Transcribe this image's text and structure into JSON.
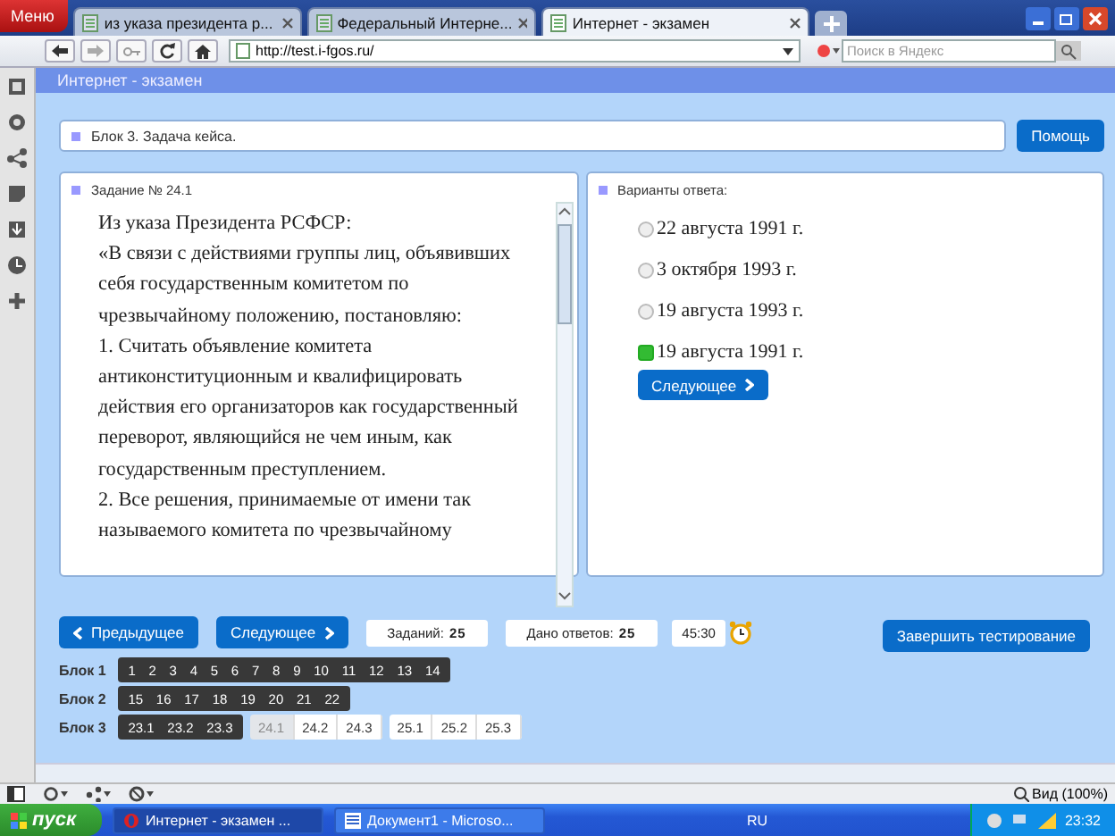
{
  "browser": {
    "menu": "Меню",
    "tabs": [
      {
        "label": "из указа президента р...",
        "selected": false
      },
      {
        "label": "Федеральный Интерне...",
        "selected": false
      },
      {
        "label": "Интернет - экзамен",
        "selected": true
      }
    ],
    "url": "http://test.i-fgos.ru/",
    "search": {
      "placeholder": "Поиск в Яндекс"
    }
  },
  "page_title": "Интернет - экзамен",
  "block_label": "Блок 3. Задача кейса.",
  "help_button": "Помощь",
  "task": {
    "title": "Задание № 24.1",
    "paragraphs": [
      "Из указа Президента РСФСР:",
      "«В связи с действиями группы лиц, объявивших себя государственным комитетом по чрезвычайному положению, постановляю:",
      "1. Считать объявление комитета антиконституционным и квалифицировать действия его организаторов как государственный переворот, являющийся не чем иным, как государственным преступлением.",
      "2. Все решения, принимаемые от имени так называемого комитета по чрезвычайному"
    ]
  },
  "answers_panel": {
    "title": "Варианты ответа:",
    "next_button": "Следующее"
  },
  "answers": [
    {
      "label": "22 августа 1991 г.",
      "selected": false
    },
    {
      "label": "3 октября 1993 г.",
      "selected": false
    },
    {
      "label": "19 августа 1993 г.",
      "selected": false
    },
    {
      "label": "19 августа 1991 г.",
      "selected": true
    }
  ],
  "navigation": {
    "prev_button": "Предыдущее",
    "next_button": "Следующее",
    "tasks_label": "Заданий:",
    "tasks_count": "25",
    "answered_label": "Дано ответов:",
    "answered_count": "25",
    "timer": "45:30",
    "finish_button": "Завершить тестирование"
  },
  "blocks": [
    {
      "label": "Блок 1",
      "groups": [
        {
          "items": [
            {
              "label": "1",
              "answered": true,
              "selected": false
            },
            {
              "label": "2",
              "answered": true,
              "selected": false
            },
            {
              "label": "3",
              "answered": true,
              "selected": false
            },
            {
              "label": "4",
              "answered": true,
              "selected": false
            },
            {
              "label": "5",
              "answered": true,
              "selected": false
            },
            {
              "label": "6",
              "answered": true,
              "selected": false
            },
            {
              "label": "7",
              "answered": true,
              "selected": false
            },
            {
              "label": "8",
              "answered": true,
              "selected": false
            },
            {
              "label": "9",
              "answered": true,
              "selected": false
            },
            {
              "label": "10",
              "answered": true,
              "selected": false
            },
            {
              "label": "11",
              "answered": true,
              "selected": false
            },
            {
              "label": "12",
              "answered": true,
              "selected": false
            },
            {
              "label": "13",
              "answered": true,
              "selected": false
            },
            {
              "label": "14",
              "answered": true,
              "selected": false
            }
          ]
        }
      ]
    },
    {
      "label": "Блок 2",
      "groups": [
        {
          "items": [
            {
              "label": "15",
              "answered": true,
              "selected": false
            },
            {
              "label": "16",
              "answered": true,
              "selected": false
            },
            {
              "label": "17",
              "answered": true,
              "selected": false
            },
            {
              "label": "18",
              "answered": true,
              "selected": false
            },
            {
              "label": "19",
              "answered": true,
              "selected": false
            },
            {
              "label": "20",
              "answered": true,
              "selected": false
            },
            {
              "label": "21",
              "answered": true,
              "selected": false
            },
            {
              "label": "22",
              "answered": true,
              "selected": false
            }
          ]
        }
      ]
    },
    {
      "label": "Блок 3",
      "groups": [
        {
          "items": [
            {
              "label": "23.1",
              "answered": true,
              "selected": false
            },
            {
              "label": "23.2",
              "answered": true,
              "selected": false
            },
            {
              "label": "23.3",
              "answered": true,
              "selected": false
            }
          ]
        },
        {
          "items": [
            {
              "label": "24.1",
              "answered": false,
              "selected": true
            },
            {
              "label": "24.2",
              "answered": false,
              "selected": false
            },
            {
              "label": "24.3",
              "answered": false,
              "selected": false
            }
          ]
        },
        {
          "items": [
            {
              "label": "25.1",
              "answered": false,
              "selected": false
            },
            {
              "label": "25.2",
              "answered": false,
              "selected": false
            },
            {
              "label": "25.3",
              "answered": false,
              "selected": false
            }
          ]
        }
      ]
    }
  ],
  "status_bar": {
    "zoom": "Вид (100%)"
  },
  "taskbar": {
    "start": "пуск",
    "tasks": [
      {
        "label": "Интернет - экзамен ...",
        "selected": true
      },
      {
        "label": "Документ1 - Microso...",
        "selected": false
      }
    ],
    "language": "RU",
    "clock": "23:32"
  }
}
